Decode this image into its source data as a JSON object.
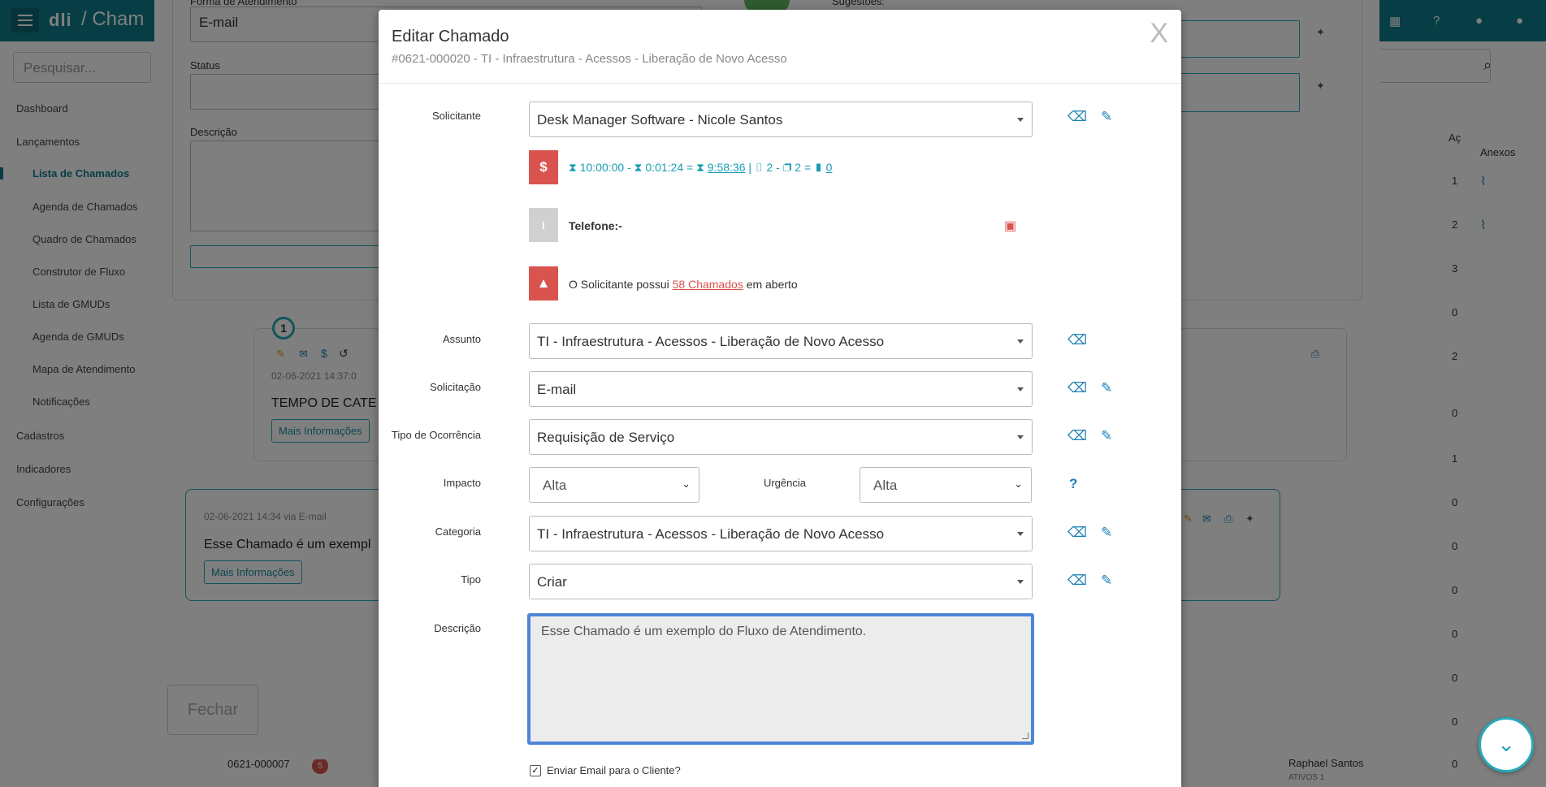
{
  "app": {
    "logo": "dli",
    "breadcrumb_sep": "/",
    "breadcrumb": "Cham"
  },
  "sidebar": {
    "search_placeholder": "Pesquisar...",
    "items": [
      {
        "label": "Dashboard"
      },
      {
        "label": "Lançamentos"
      },
      {
        "label": "Lista de Chamados"
      },
      {
        "label": "Agenda de Chamados"
      },
      {
        "label": "Quadro de Chamados"
      },
      {
        "label": "Construtor de Fluxo"
      },
      {
        "label": "Lista de GMUDs"
      },
      {
        "label": "Agenda de GMUDs"
      },
      {
        "label": "Mapa de Atendimento"
      },
      {
        "label": "Notificações"
      },
      {
        "label": "Cadastros"
      },
      {
        "label": "Indicadores"
      },
      {
        "label": "Configurações"
      }
    ]
  },
  "background": {
    "forma_label": "Forma de Atendimento",
    "forma_value": "E-mail",
    "status_label": "Status",
    "descricao_label": "Descrição",
    "sugestoes_label": "Sugestões:",
    "col_acoes": "Aç",
    "col_anexos": "Anexos",
    "counts": [
      "1",
      "2",
      "3",
      "0",
      "2",
      "0",
      "1",
      "0",
      "0",
      "0",
      "0",
      "0",
      "0",
      "0"
    ],
    "card1": {
      "number": "1",
      "timestamp": "02-06-2021 14:37:0",
      "text": "TEMPO DE CATE",
      "more": "Mais Informações"
    },
    "card2": {
      "timestamp": "02-06-2021 14:34 via E-mail",
      "text": "Esse Chamado é um exempl",
      "more": "Mais Informações"
    },
    "fechar": "Fechar",
    "bottom_row": {
      "ticket": "0621-000007",
      "badge": "5",
      "person": "Raphael Santos",
      "status": "ATIVOS 1"
    }
  },
  "modal": {
    "title": "Editar Chamado",
    "subtitle": "#0621-000020 - TI - Infraestrutura - Acessos - Liberação de Novo Acesso",
    "close": "X",
    "solicitante": {
      "label": "Solicitante",
      "value": "Desk Manager Software - Nicole Santos"
    },
    "time_info": {
      "t1": "10:00:00",
      "op1": "-",
      "t2": "0:01:24",
      "op2": "=",
      "t3": "9:58:36",
      "sep": "|",
      "n1": "2",
      "op3": "-",
      "n2": "2",
      "op4": "=",
      "n3": "0"
    },
    "telefone_label": "Telefone:",
    "telefone_value": "-",
    "alert": {
      "prefix": "O Solicitante possui",
      "link": "58 Chamados",
      "suffix": "em aberto"
    },
    "assunto": {
      "label": "Assunto",
      "value": "TI - Infraestrutura - Acessos - Liberação de Novo Acesso"
    },
    "solicitacao": {
      "label": "Solicitação",
      "value": "E-mail"
    },
    "tipo_ocorrencia": {
      "label": "Tipo de Ocorrência",
      "value": "Requisição de Serviço"
    },
    "impacto": {
      "label": "Impacto",
      "value": "Alta"
    },
    "urgencia": {
      "label": "Urgência",
      "value": "Alta"
    },
    "help": "?",
    "categoria": {
      "label": "Categoria",
      "value": "TI - Infraestrutura - Acessos - Liberação de Novo Acesso"
    },
    "tipo": {
      "label": "Tipo",
      "value": "Criar"
    },
    "descricao": {
      "label": "Descrição",
      "value": "Esse Chamado é um exemplo do Fluxo de Atendimento."
    },
    "enviar_email": "Enviar Email para o Cliente?"
  },
  "colors": {
    "teal": "#0e7d8a",
    "accent": "#27a9b8",
    "danger": "#d9534f",
    "link_blue": "#1a7fb5"
  }
}
